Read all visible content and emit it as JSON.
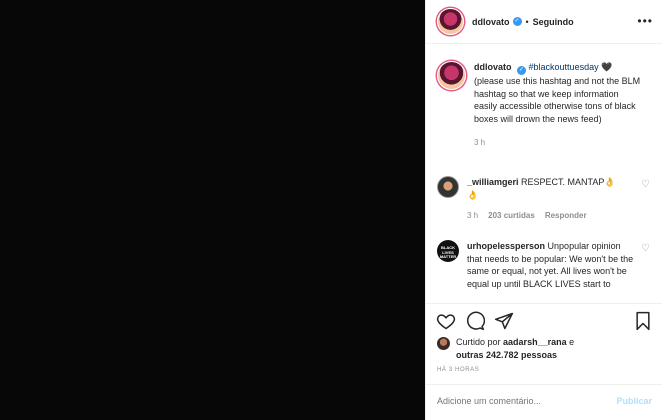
{
  "header": {
    "username": "ddlovato",
    "separator": "•",
    "follow_state": "Seguindo",
    "more_icon": "more-dots-icon"
  },
  "caption": {
    "username": "ddlovato",
    "hashtag": "#blackouttuesday",
    "emoji": "🖤",
    "text": "(please use this hashtag and not the BLM hashtag so that we keep information easily accessible otherwise tons of black boxes will drown the news feed)",
    "time": "3 h"
  },
  "comments": [
    {
      "username": "_williamgeri",
      "text": "RESPECT. MANTAP👌",
      "text2": "👌",
      "time": "3 h",
      "likes": "203 curtidas",
      "reply": "Responder"
    },
    {
      "username": "urhopelessperson",
      "avatar_text": "BLACK LIVES MATTER",
      "text": "Unpopular opinion that needs to be popular: We won't be the same or equal, not yet. All lives won't be equal up until BLACK LIVES start to"
    }
  ],
  "likes": {
    "prefix": "Curtido por",
    "user": "aadarsh__rana",
    "conj": "e",
    "others": "outras 242.782 pessoas"
  },
  "timestamp": "HÁ 3 HORAS",
  "add_comment": {
    "placeholder": "Adicione um comentário...",
    "post_label": "Publicar"
  },
  "colors": {
    "media_bg": "#070707",
    "link": "#00376b",
    "verified": "#3897f0",
    "post_disabled": "#b2dffc"
  }
}
